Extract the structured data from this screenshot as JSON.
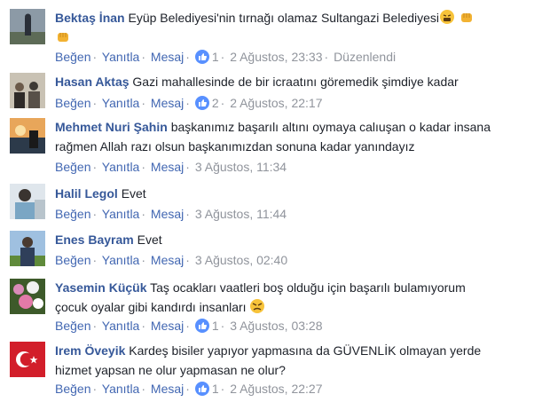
{
  "comments": [
    {
      "author": "Bektaş İnan",
      "text": "Eyüp Belediyesi'nin tırnağı olamaz Sultangazi Belediyesi",
      "emojis": [
        "tired-face-emoji",
        "fist-emoji",
        "fist-emoji"
      ],
      "like": "Beğen",
      "reply": "Yanıtla",
      "message": "Mesaj",
      "reactions": "1",
      "time": "2 Ağustos, 23:33",
      "edited": "Düzenlendi"
    },
    {
      "author": "Hasan Aktaş",
      "text": "Gazi mahallesinde de bir icraatını göremedik şimdiye kadar",
      "like": "Beğen",
      "reply": "Yanıtla",
      "message": "Mesaj",
      "reactions": "2",
      "time": "2 Ağustos, 22:17"
    },
    {
      "author": "Mehmet Nuri Şahin",
      "text_line1": "başkanımız başarılı altını oymaya calıuşan o kadar insana",
      "text_line2": "rağmen Allah razı olsun başkanımızdan sonuna kadar yanındayız",
      "like": "Beğen",
      "reply": "Yanıtla",
      "message": "Mesaj",
      "time": "3 Ağustos, 11:34"
    },
    {
      "author": "Halil Legol",
      "text": "Evet",
      "like": "Beğen",
      "reply": "Yanıtla",
      "message": "Mesaj",
      "time": "3 Ağustos, 11:44"
    },
    {
      "author": "Enes Bayram",
      "text": "Evet",
      "like": "Beğen",
      "reply": "Yanıtla",
      "message": "Mesaj",
      "time": "3 Ağustos, 02:40"
    },
    {
      "author": "Yasemin Küçük",
      "text_line1": "Taş ocakları vaatleri boş olduğu için başarılı bulamıyorum",
      "text_line2": "çocuk oyalar gibi kandırdı insanları",
      "emojis": [
        "angry-face-emoji"
      ],
      "like": "Beğen",
      "reply": "Yanıtla",
      "message": "Mesaj",
      "reactions": "1",
      "time": "3 Ağustos, 03:28"
    },
    {
      "author": "Irem Öveyik",
      "text_line1": "Kardeş bisiler yapıyor yapmasına da GÜVENLİK olmayan yerde",
      "text_line2": "hizmet yapsan ne olur yapmasan ne olur?",
      "like": "Beğen",
      "reply": "Yanıtla",
      "message": "Mesaj",
      "reactions": "1",
      "time": "2 Ağustos, 22:27"
    }
  ],
  "colors": {
    "author": "#365899",
    "link": "#4267b2",
    "meta": "#90949c",
    "like_badge": "#5890ff"
  }
}
